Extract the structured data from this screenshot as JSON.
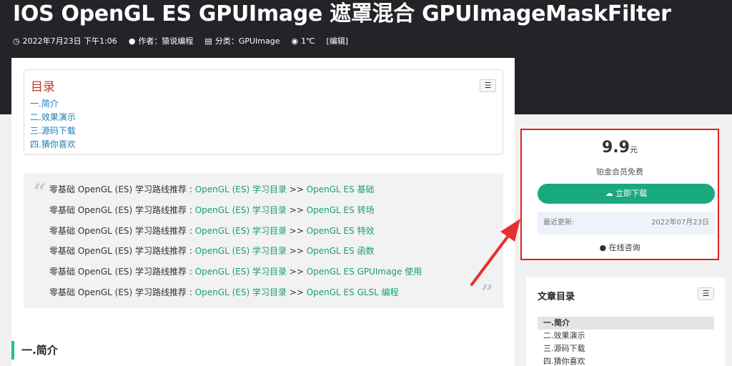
{
  "post": {
    "title": "IOS OpenGL ES GPUImage 遮罩混合 GPUImageMaskFilter",
    "date": "2022年7月23日 下午1:06",
    "author": "作者：猿说编程",
    "category": "分类：GPUImage",
    "views": "1℃",
    "edit": "[编辑]"
  },
  "icons": {
    "clock": "clock-icon",
    "user": "user-icon",
    "folder": "folder-icon",
    "eye": "eye-icon",
    "cloud": "cloud-download-icon",
    "qq": "qq-icon",
    "list": "list-icon"
  },
  "toc": {
    "title": "目录",
    "items": [
      "一.简介",
      "二.效果演示",
      "三.源码下载",
      "四.猜你喜欢"
    ]
  },
  "quote": {
    "prefix": "零基础 OpenGL (ES) 学习路线推荐 : ",
    "link": "OpenGL (ES) 学习目录",
    "sep": " >> ",
    "targets": [
      "OpenGL ES 基础",
      "OpenGL ES 转场",
      "OpenGL ES 特效",
      "OpenGL ES 函数",
      "OpenGL ES GPUImage 使用",
      "OpenGL ES GLSL 编程"
    ]
  },
  "section": {
    "heading": "一.简介"
  },
  "download": {
    "price": "9.9",
    "unit": "元",
    "vip": "铂金会员免费",
    "button": "立即下载",
    "updated_label": "最近更新:",
    "updated_date": "2022年07月23日",
    "consult": "在线咨询"
  },
  "sidebar_toc": {
    "title": "文章目录",
    "items": [
      "一.简介",
      "二.效果演示",
      "三.源码下载",
      "四.猜你喜欢"
    ]
  },
  "colors": {
    "accent": "#1aa97f",
    "link": "#1a9c7b",
    "highlight": "#e02020",
    "toc_title": "#c0392b"
  }
}
